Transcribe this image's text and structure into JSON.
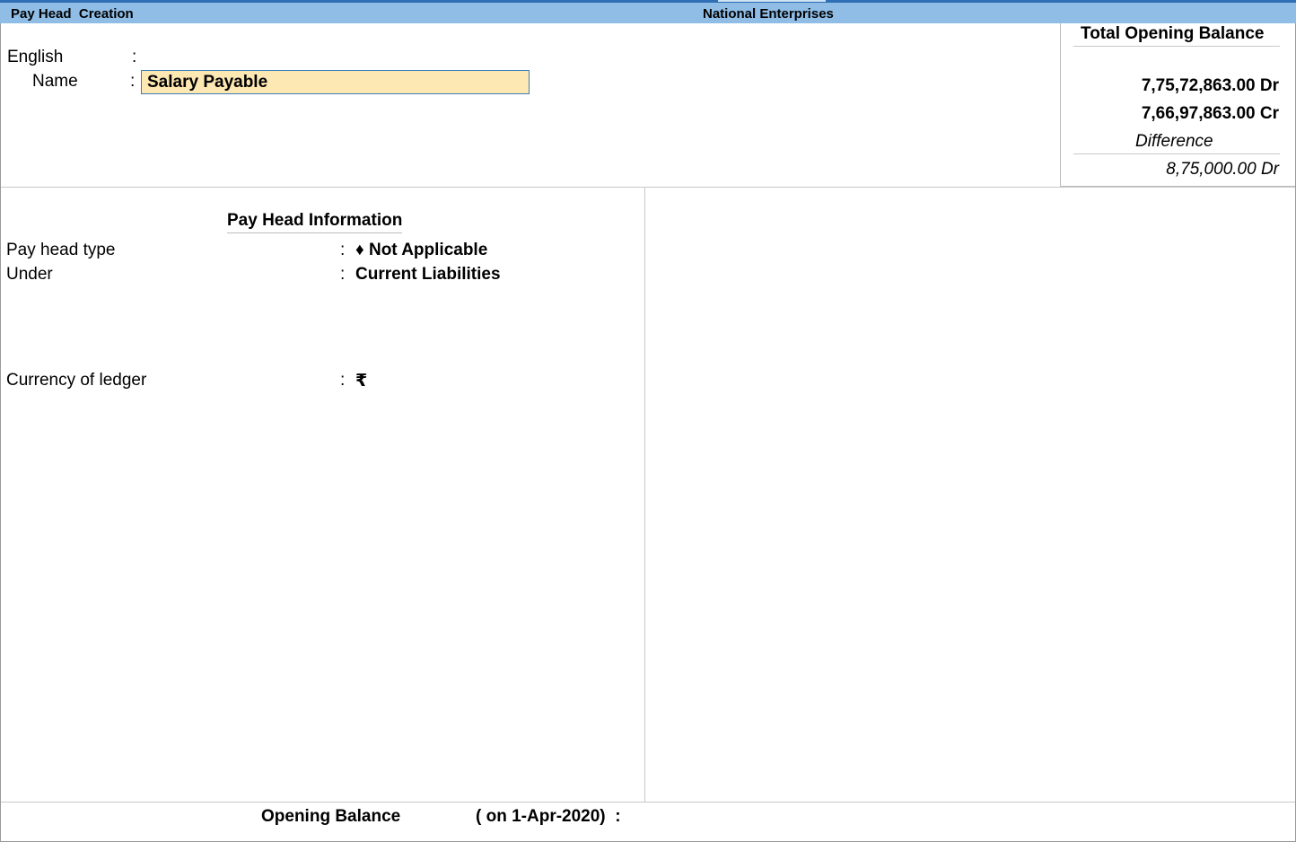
{
  "window": {
    "screen_title": "Pay Head  Creation",
    "company": "National Enterprises"
  },
  "header": {
    "language_label": "English",
    "name_label": "Name",
    "name_value": "Salary Payable"
  },
  "balance": {
    "title": "Total Opening Balance",
    "debit": "7,75,72,863.00 Dr",
    "credit": "7,66,97,863.00 Cr",
    "difference_label": "Difference",
    "difference_value": "8,75,000.00 Dr"
  },
  "info": {
    "title": "Pay Head Information",
    "pay_head_type_label": "Pay head type",
    "pay_head_type_value": "♦ Not Applicable",
    "under_label": "Under",
    "under_value": "Current Liabilities",
    "currency_label": "Currency of ledger",
    "currency_value": "₹"
  },
  "footer": {
    "opening_balance_label": "Opening Balance",
    "opening_balance_date": "( on 1-Apr-2020)  :"
  },
  "colors": {
    "titlebar": "#8fbde6",
    "input_bg": "#fde7b2",
    "input_border": "#3a7fb8"
  }
}
